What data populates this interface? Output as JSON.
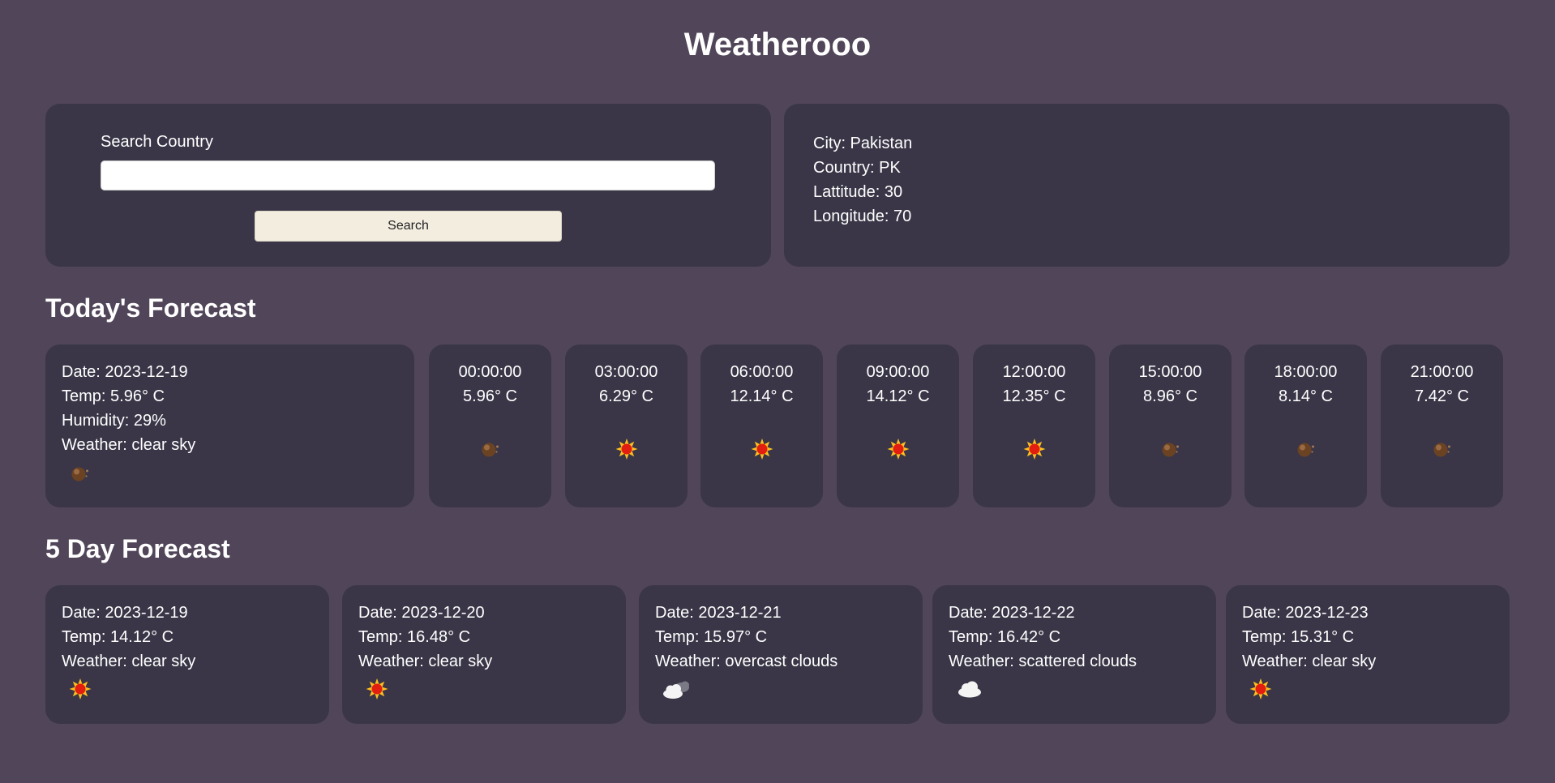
{
  "app": {
    "title": "Weatherooo"
  },
  "search": {
    "label": "Search Country",
    "value": "",
    "placeholder": "",
    "button_label": "Search"
  },
  "location": {
    "city_line": "City: Pakistan",
    "country_line": "Country: PK",
    "latitude_line": "Lattitude: 30",
    "longitude_line": "Longitude: 70"
  },
  "today": {
    "section_title": "Today's Forecast",
    "date_line": "Date: 2023-12-19",
    "temp_line": "Temp: 5.96° C",
    "humidity_line": "Humidity: 29%",
    "weather_line": "Weather: clear sky",
    "icon": "clear-night-icon",
    "hours": [
      {
        "time": "00:00:00",
        "temp": "5.96° C",
        "icon": "clear-night-icon"
      },
      {
        "time": "03:00:00",
        "temp": "6.29° C",
        "icon": "sun-icon"
      },
      {
        "time": "06:00:00",
        "temp": "12.14° C",
        "icon": "sun-icon"
      },
      {
        "time": "09:00:00",
        "temp": "14.12° C",
        "icon": "sun-icon"
      },
      {
        "time": "12:00:00",
        "temp": "12.35° C",
        "icon": "sun-icon"
      },
      {
        "time": "15:00:00",
        "temp": "8.96° C",
        "icon": "clear-night-icon"
      },
      {
        "time": "18:00:00",
        "temp": "8.14° C",
        "icon": "clear-night-icon"
      },
      {
        "time": "21:00:00",
        "temp": "7.42° C",
        "icon": "clear-night-icon"
      }
    ]
  },
  "five_day": {
    "section_title": "5 Day Forecast",
    "days": [
      {
        "date_line": "Date: 2023-12-19",
        "temp_line": "Temp: 14.12° C",
        "weather_line": "Weather: clear sky",
        "icon": "sun-icon"
      },
      {
        "date_line": "Date: 2023-12-20",
        "temp_line": "Temp: 16.48° C",
        "weather_line": "Weather: clear sky",
        "icon": "sun-icon"
      },
      {
        "date_line": "Date: 2023-12-21",
        "temp_line": "Temp: 15.97° C",
        "weather_line": "Weather: overcast clouds",
        "icon": "overcast-clouds-icon"
      },
      {
        "date_line": "Date: 2023-12-22",
        "temp_line": "Temp: 16.42° C",
        "weather_line": "Weather: scattered clouds",
        "icon": "cloud-icon"
      },
      {
        "date_line": "Date: 2023-12-23",
        "temp_line": "Temp: 15.31° C",
        "weather_line": "Weather: clear sky",
        "icon": "sun-icon"
      }
    ]
  },
  "colors": {
    "page_background": "#514559",
    "card_background": "#3a3647",
    "button_background": "#f3ede0",
    "text": "#ffffff"
  }
}
